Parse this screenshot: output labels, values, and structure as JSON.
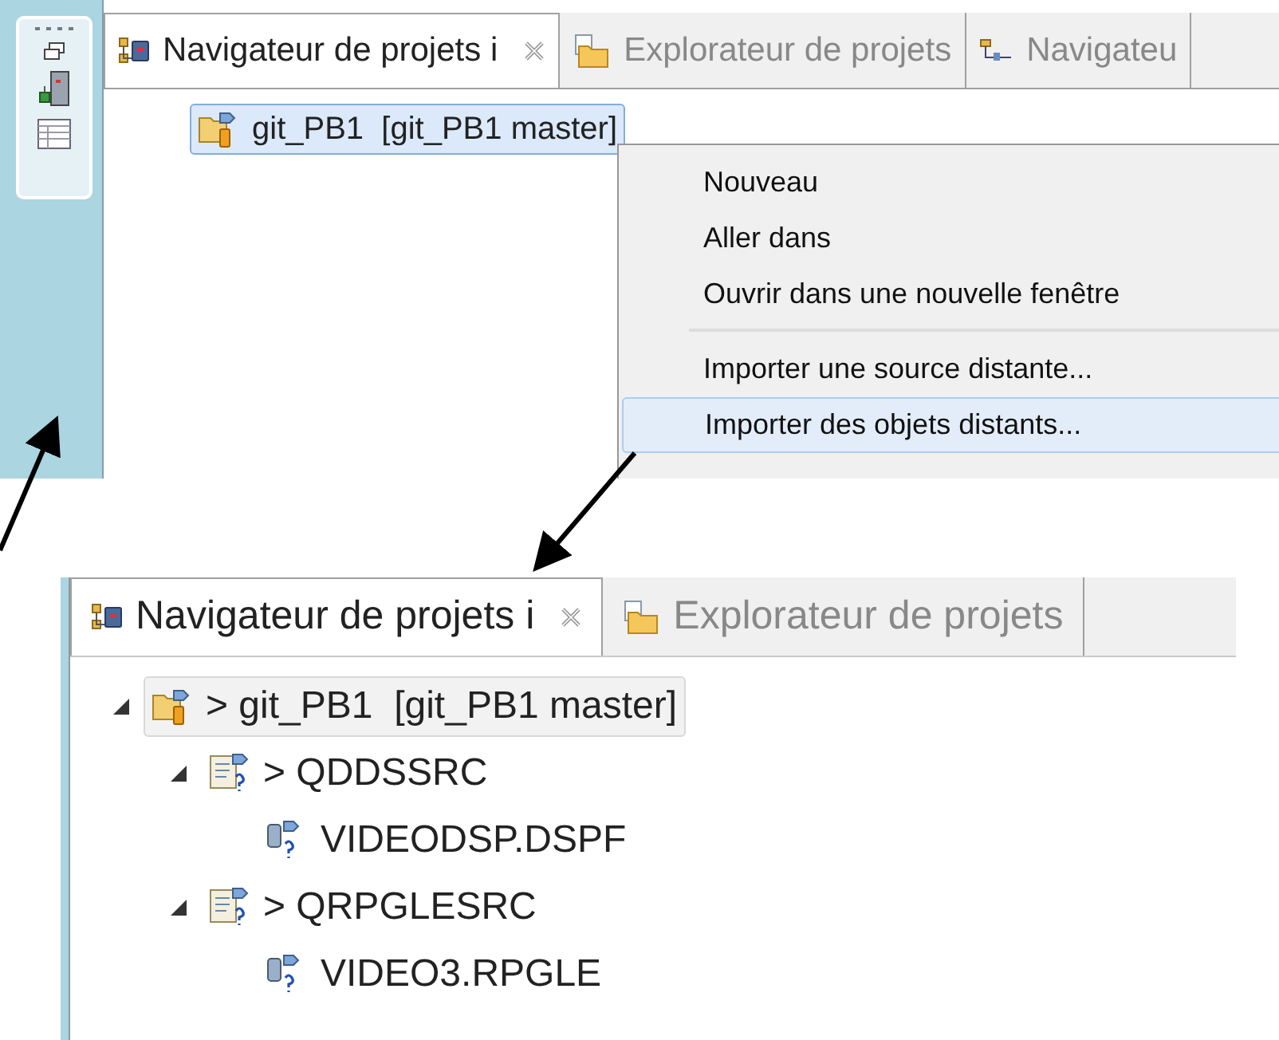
{
  "top_view": {
    "tabs": [
      {
        "label": "Navigateur de projets i",
        "kind": "navigator",
        "selected": true,
        "closable": true
      },
      {
        "label": "Explorateur de projets",
        "kind": "explorer",
        "selected": false,
        "closable": false
      },
      {
        "label": "Navigateu",
        "kind": "outline",
        "selected": false,
        "closable": false
      }
    ],
    "tree": [
      {
        "label": "git_PB1  [git_PB1 master]",
        "kind": "project",
        "selected": true
      }
    ],
    "context_menu": {
      "groups": [
        [
          {
            "label": "Nouveau",
            "selected": false
          },
          {
            "label": "Aller dans",
            "selected": false
          },
          {
            "label": "Ouvrir dans une nouvelle fenêtre",
            "selected": false
          }
        ],
        [
          {
            "label": "Importer une source distante...",
            "selected": false
          },
          {
            "label": "Importer des objets distants...",
            "selected": true
          }
        ]
      ]
    }
  },
  "bottom_view": {
    "tabs": [
      {
        "label": "Navigateur de projets i",
        "kind": "navigator",
        "selected": true,
        "closable": true
      },
      {
        "label": "Explorateur de projets",
        "kind": "explorer",
        "selected": false,
        "closable": false
      }
    ],
    "tree": [
      {
        "label": "> git_PB1  [git_PB1 master]",
        "kind": "project",
        "selected": true,
        "expanded": true,
        "children": [
          {
            "label": "> QDDSSRC",
            "kind": "folder",
            "selected": false,
            "expanded": true,
            "children": [
              {
                "label": "VIDEODSP.DSPF",
                "kind": "member",
                "selected": false
              }
            ]
          },
          {
            "label": "> QRPGLESRC",
            "kind": "folder",
            "selected": false,
            "expanded": true,
            "children": [
              {
                "label": "VIDEO3.RPGLE",
                "kind": "member",
                "selected": false
              }
            ]
          }
        ]
      }
    ]
  }
}
